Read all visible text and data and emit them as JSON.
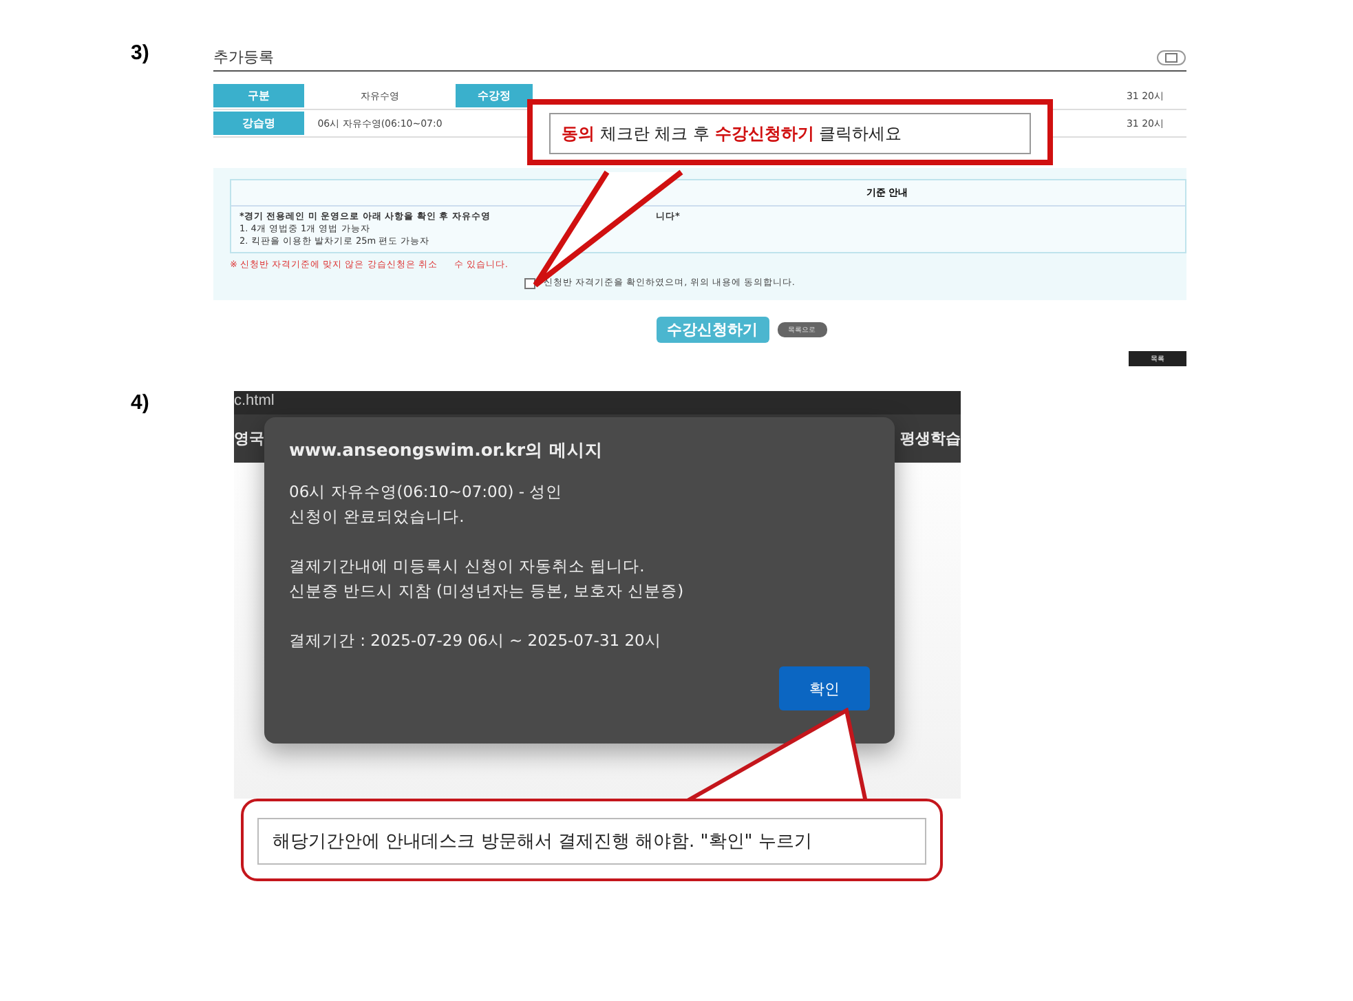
{
  "step3": {
    "number": "3)",
    "page_title": "추가등록",
    "info_rows": [
      {
        "cells": [
          "구분",
          "자유수영",
          "수강정"
        ],
        "tail": "31 20시"
      },
      {
        "cells": [
          "강습명",
          "06시 자유수영(06:10~07:0"
        ],
        "tail": "31 20시"
      }
    ],
    "notice": {
      "title": "기준 안내",
      "lead": "*경기 전용레인 미 운영으로 아래 사항을 확인 후 자유수영",
      "lead_end": "니다*",
      "items": [
        "1. 4개 영법중 1개 영법 가능자",
        "2. 킥판을 이용한 발차기로 25m 편도 가능자"
      ]
    },
    "warning": "※ 신청반 자격기준에 맞지 않은 강습신청은 취소",
    "warning_end": "수 있습니다.",
    "agree": {
      "label": "신청반 자격기준을 확인하였으며, 위의 내용에 동의합니다.",
      "checked": false
    },
    "apply_button": "수강신청하기",
    "list_button": "목록으로",
    "bottom_button": "목록",
    "callout": {
      "strong1": "동의",
      "mid": " 체크란 체크 후 ",
      "strong2": "수강신청하기",
      "end": " 클릭하세요"
    }
  },
  "step4": {
    "number": "4)",
    "address": "c.html",
    "nav_left": "영국",
    "nav_right": "평생학습",
    "dialog": {
      "title": "www.anseongswim.or.kr의 메시지",
      "paragraphs": [
        [
          "06시 자유수영(06:10~07:00) - 성인",
          "신청이 완료되었습니다."
        ],
        [
          "결제기간내에 미등록시 신청이 자동취소 됩니다.",
          "신분증 반드시 지참 (미성년자는 등본, 보호자 신분증)"
        ],
        [
          "결제기간 : 2025-07-29 06시 ~ 2025-07-31 20시"
        ]
      ],
      "ok_button": "확인"
    },
    "callout": "해당기간안에 안내데스크 방문해서 결제진행 해야함. \"확인\" 누르기"
  }
}
